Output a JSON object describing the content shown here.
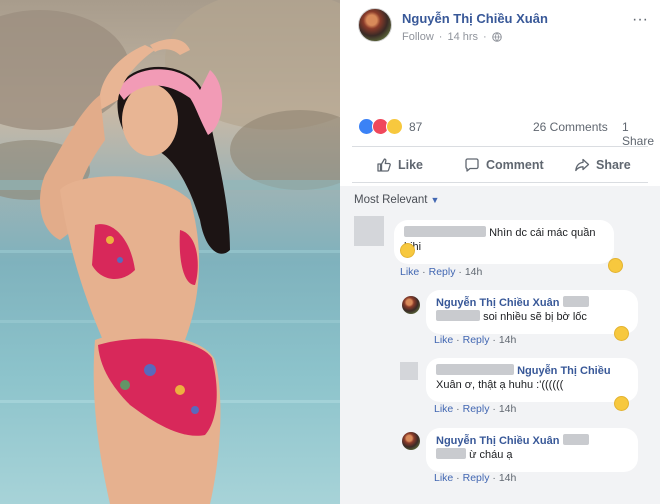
{
  "post": {
    "author": "Nguyễn Thị Chiều Xuân",
    "follow_label": "Follow",
    "separator": "·",
    "time": "14 hrs",
    "more": "···",
    "reaction_count": "87",
    "comments_count": "26 Comments",
    "shares_count": "1 Share"
  },
  "actions": {
    "like": "Like",
    "comment": "Comment",
    "share": "Share"
  },
  "sort": {
    "label": "Most Relevant",
    "caret": "▼"
  },
  "comments": [
    {
      "text": "Nhìn dc cái mác quần hihi",
      "like": "Like",
      "reply": "Reply",
      "time": "14h"
    },
    {
      "name": "Nguyễn Thị Chiều Xuân",
      "text": "soi nhiều sẽ bị bờ lốc",
      "like": "Like",
      "reply": "Reply",
      "time": "14h"
    },
    {
      "name_inline": "Nguyễn Thị Chiều",
      "text": "Xuân ơ, thật ạ huhu :'((((((",
      "like": "Like",
      "reply": "Reply",
      "time": "14h"
    },
    {
      "name": "Nguyễn Thị Chiều Xuân",
      "text": "ừ cháu ạ",
      "like": "Like",
      "reply": "Reply",
      "time": "14h"
    }
  ],
  "colors": {
    "link_blue": "#385898",
    "comment_bg": "#f2f3f5",
    "like_blue": "#3b82f6",
    "love_red": "#f0485c",
    "emoji_yellow": "#f7c83e"
  },
  "icons": [
    "globe-icon",
    "more-icon",
    "like-thumb-icon",
    "comment-bubble-icon",
    "share-arrow-icon",
    "reaction-like-icon",
    "reaction-love-icon",
    "reaction-wow-icon",
    "laugh-emoji-icon",
    "cry-emoji-icon",
    "wow-emoji-icon"
  ]
}
